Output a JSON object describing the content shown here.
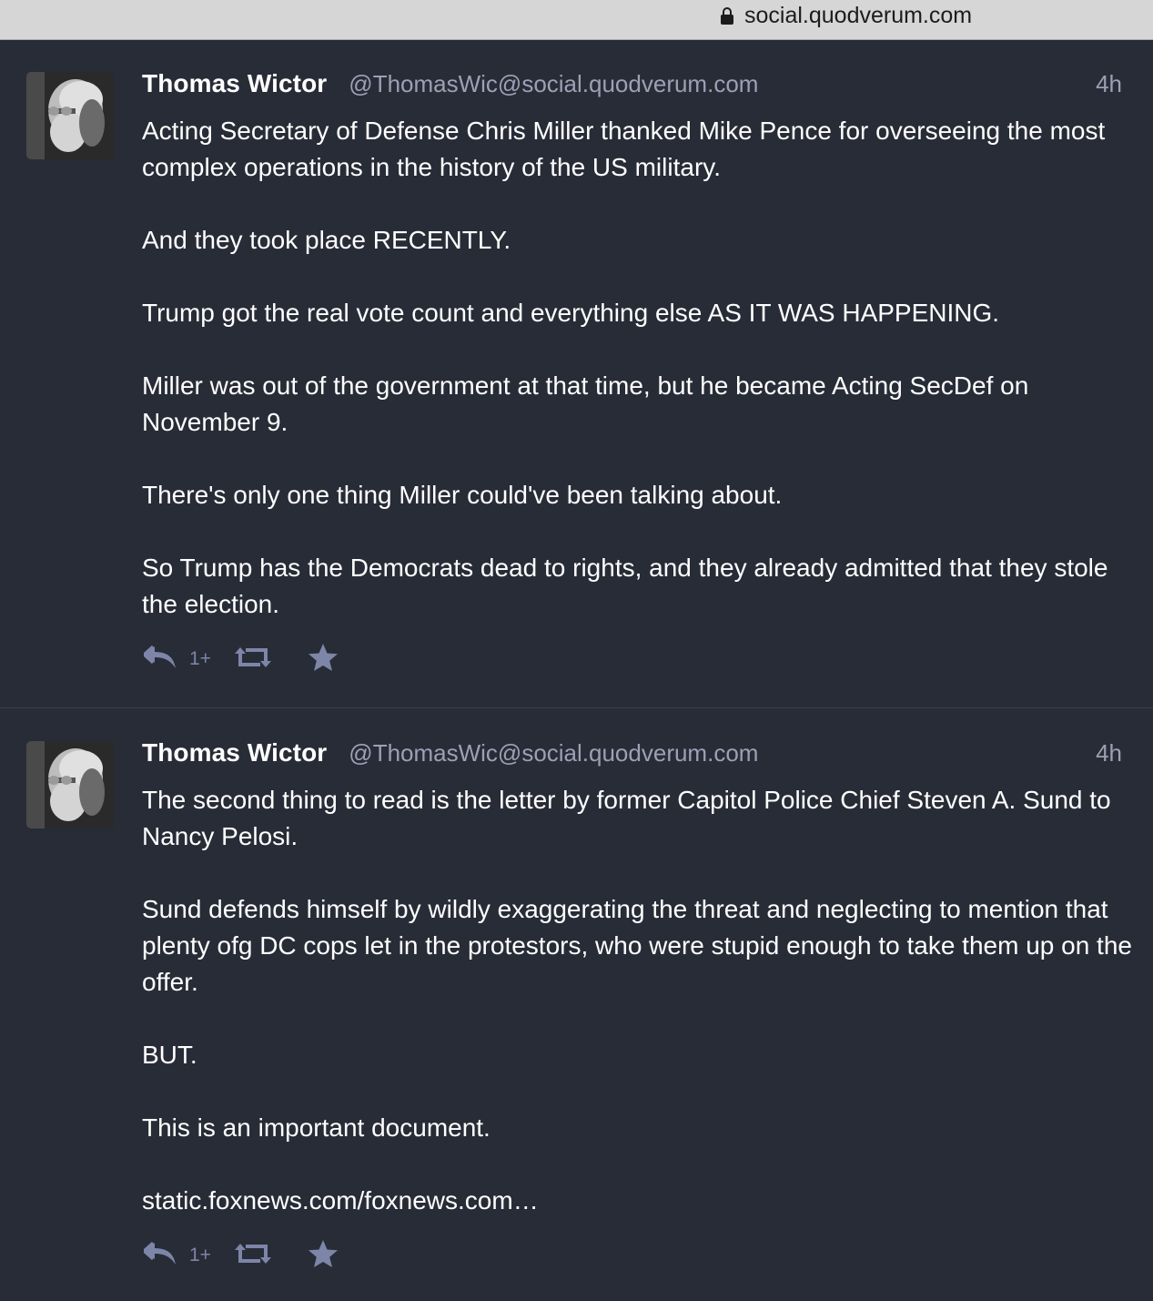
{
  "browser": {
    "url": "social.quodverum.com",
    "lock_icon": "lock-icon"
  },
  "colors": {
    "background": "#282c37",
    "secondary_text": "#9ba1b5",
    "action_icons": "#7d85a8"
  },
  "statuses": [
    {
      "display_name": "Thomas Wictor",
      "account": "@ThomasWic@social.quodverum.com",
      "time": "4h",
      "paragraphs": [
        "Acting Secretary of Defense Chris Miller thanked Mike Pence for overseeing the most complex operations in the history of the US military.",
        "And they took place RECENTLY.",
        "Trump got the real vote count and everything else AS IT WAS HAPPENING.",
        "Miller was out of the government at that time, but he became Acting SecDef on November 9.",
        "There's only one thing Miller could've been talking about.",
        "So Trump has the Democrats dead to rights, and they already admitted that they stole the election."
      ],
      "reply_count": "1+"
    },
    {
      "display_name": "Thomas Wictor",
      "account": "@ThomasWic@social.quodverum.com",
      "time": "4h",
      "paragraphs": [
        "The second thing to read is the letter by former Capitol Police Chief Steven A. Sund to Nancy Pelosi.",
        "Sund defends himself by wildly exaggerating the threat and neglecting to mention that plenty ofg DC cops let in the protestors, who were stupid enough to take them up on the offer.",
        "BUT.",
        "This is an important document."
      ],
      "link": "static.foxnews.com/foxnews.com…",
      "reply_count": "1+"
    }
  ]
}
